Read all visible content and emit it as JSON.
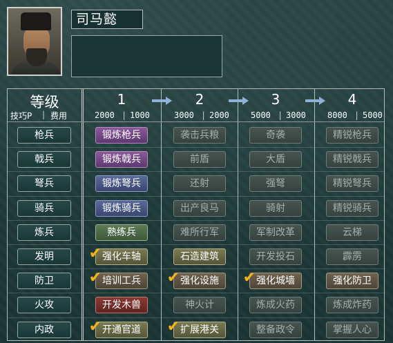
{
  "officer": {
    "name": "司马懿",
    "description": ""
  },
  "header": {
    "title": "等级",
    "sub_left": "技巧P",
    "sub_right": "费用",
    "levels": [
      {
        "num": "1",
        "tech_cost": "2000",
        "gold_cost": "1000"
      },
      {
        "num": "2",
        "tech_cost": "3000",
        "gold_cost": "2000"
      },
      {
        "num": "3",
        "tech_cost": "5000",
        "gold_cost": "3000"
      },
      {
        "num": "4",
        "tech_cost": "8000",
        "gold_cost": "5000"
      }
    ]
  },
  "rows": [
    {
      "category": "枪兵",
      "skills": [
        {
          "label": "锻炼枪兵",
          "style": "purple",
          "checked": false
        },
        {
          "label": "袭击兵粮",
          "style": "dim",
          "checked": false
        },
        {
          "label": "奇袭",
          "style": "dim",
          "checked": false
        },
        {
          "label": "精锐枪兵",
          "style": "dim",
          "checked": false
        }
      ]
    },
    {
      "category": "戟兵",
      "skills": [
        {
          "label": "锻炼戟兵",
          "style": "purple",
          "checked": false
        },
        {
          "label": "前盾",
          "style": "dim",
          "checked": false
        },
        {
          "label": "大盾",
          "style": "dim",
          "checked": false
        },
        {
          "label": "精锐戟兵",
          "style": "dim",
          "checked": false
        }
      ]
    },
    {
      "category": "弩兵",
      "skills": [
        {
          "label": "锻炼弩兵",
          "style": "blue",
          "checked": false
        },
        {
          "label": "还射",
          "style": "dim",
          "checked": false
        },
        {
          "label": "强弩",
          "style": "dim",
          "checked": false
        },
        {
          "label": "精锐弩兵",
          "style": "dim",
          "checked": false
        }
      ]
    },
    {
      "category": "骑兵",
      "skills": [
        {
          "label": "锻炼骑兵",
          "style": "blue",
          "checked": false
        },
        {
          "label": "出产良马",
          "style": "dim",
          "checked": false
        },
        {
          "label": "骑射",
          "style": "dim",
          "checked": false
        },
        {
          "label": "精锐骑兵",
          "style": "dim",
          "checked": false
        }
      ]
    },
    {
      "category": "炼兵",
      "skills": [
        {
          "label": "熟练兵",
          "style": "green",
          "checked": false
        },
        {
          "label": "难所行军",
          "style": "dim",
          "checked": false
        },
        {
          "label": "军制改革",
          "style": "dim",
          "checked": false
        },
        {
          "label": "云梯",
          "style": "dim",
          "checked": false
        }
      ]
    },
    {
      "category": "发明",
      "skills": [
        {
          "label": "强化车轴",
          "style": "olive",
          "checked": true
        },
        {
          "label": "石造建筑",
          "style": "olive",
          "checked": false
        },
        {
          "label": "开发投石",
          "style": "dim",
          "checked": false
        },
        {
          "label": "霹雳",
          "style": "dim",
          "checked": false
        }
      ]
    },
    {
      "category": "防卫",
      "skills": [
        {
          "label": "培训工兵",
          "style": "tan",
          "checked": true
        },
        {
          "label": "强化设施",
          "style": "tan",
          "checked": true
        },
        {
          "label": "强化城墙",
          "style": "tan",
          "checked": true
        },
        {
          "label": "强化防卫",
          "style": "tan",
          "checked": false
        }
      ]
    },
    {
      "category": "火攻",
      "skills": [
        {
          "label": "开发木兽",
          "style": "red",
          "checked": false
        },
        {
          "label": "神火计",
          "style": "dim",
          "checked": false
        },
        {
          "label": "炼成火药",
          "style": "dim",
          "checked": false
        },
        {
          "label": "炼成炸药",
          "style": "dim",
          "checked": false
        }
      ]
    },
    {
      "category": "内政",
      "skills": [
        {
          "label": "开通官道",
          "style": "olive",
          "checked": true
        },
        {
          "label": "扩展港关",
          "style": "olive",
          "checked": true
        },
        {
          "label": "整备政令",
          "style": "dim",
          "checked": false
        },
        {
          "label": "掌握人心",
          "style": "dim",
          "checked": false
        }
      ]
    }
  ],
  "icons": {
    "check": "checkmark-icon",
    "arrow": "right-arrow-icon"
  }
}
